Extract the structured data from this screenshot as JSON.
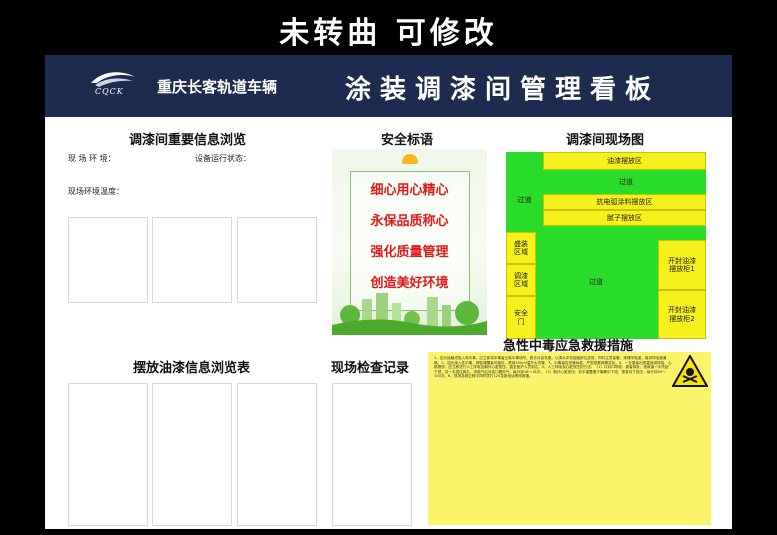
{
  "top_caption": "未转曲  可修改",
  "header": {
    "logo_text": "CQCK",
    "company": "重庆长客轨道车辆",
    "title": "涂装调漆间管理看板"
  },
  "sections": {
    "info_browse": {
      "title": "调漆间重要信息浏览",
      "env_label": "现 场 环 境：",
      "device_label": "设备运行状态：",
      "temp_label": "现场环境温度："
    },
    "safety": {
      "title": "安全标语",
      "slogans": [
        "细心用心精心",
        "永保品质称心",
        "强化质量管理",
        "创造美好环境"
      ]
    },
    "site_map": {
      "title": "调漆间现场图",
      "zones": {
        "paint_area": "油漆摆放区",
        "aisle_top": "过道",
        "aisle_left": "过道",
        "arc_paint": "抗电弧涂料摆放区",
        "putty": "腻子摆放区",
        "container": "盛装\n区域",
        "mix": "调漆\n区域",
        "safe_door": "安全\n门",
        "aisle_center": "过道",
        "cabinet1": "开封油漆\n摆放柜1",
        "cabinet2": "开封油漆\n摆放柜2"
      }
    },
    "paint_list": {
      "title": "摆放油漆信息浏览表"
    },
    "inspection": {
      "title": "现场检查记录"
    },
    "rescue": {
      "title": "急性中毒应急救援措施",
      "body": "1、如为接触或吸入而中毒，应立即将中毒者迁离中毒场所，脱去污染衣服，以清水冲洗接触部位皮肤，同时注意保暖，清理呼吸道，保持呼吸道通畅。2、如为误入性中毒，神智清醒者可催吐，禁用500ml温开水洗胃。3、中毒者应安静休息，严密观察病情变化。4、一旦患者出现昏迷或呼吸、心跳骤停，应立即进行人工呼吸及胸外心脏按压，直至医护人员到达。5、人工呼吸及心脏按压的方法：（1）口对口呼吸：患者仰卧，抢救者一手托起下颌，另一手捏住鼻孔，深吸气后对准口唇吹气，每分钟16～18次；（2）胸外心脏按压：双手重叠置于胸骨中下段，垂直向下按压，每分钟80～100次。6、现场急救过程中同时拨打120急救电话等待救援。"
    }
  }
}
